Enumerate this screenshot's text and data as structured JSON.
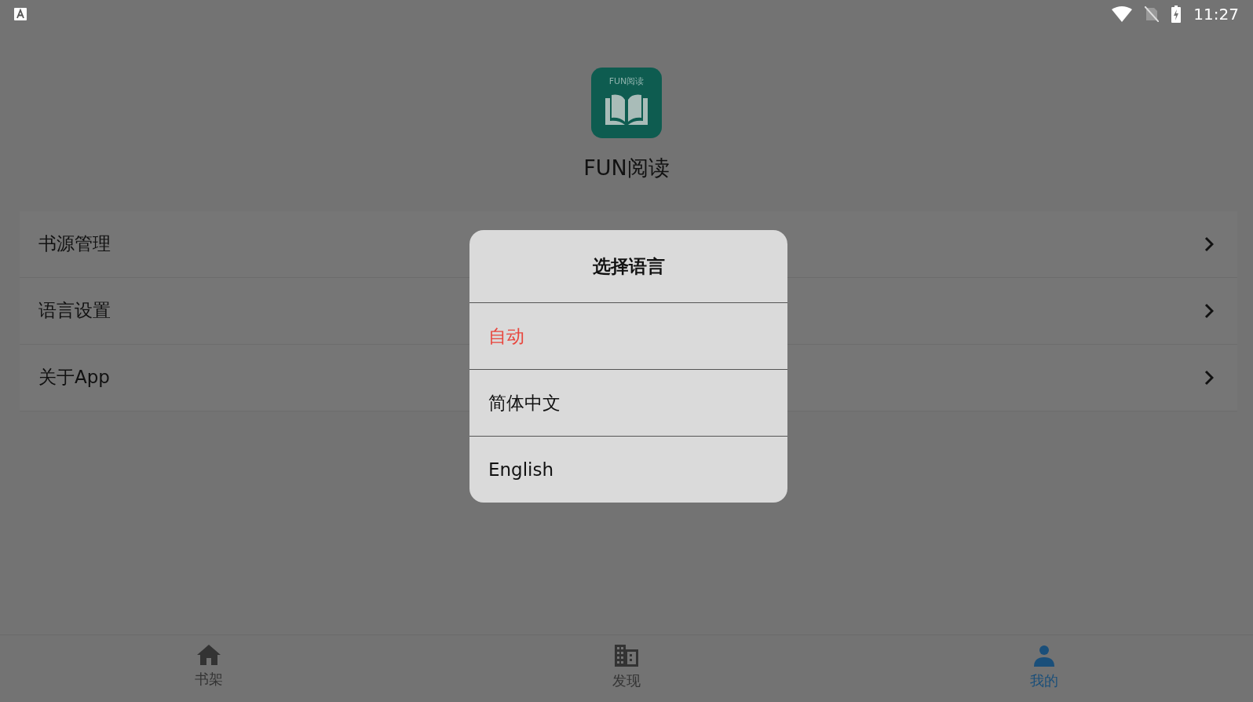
{
  "status_bar": {
    "time": "11:27"
  },
  "app": {
    "logo_text": "FUN阅读",
    "name": "FUN阅读"
  },
  "menu": [
    {
      "label": "书源管理"
    },
    {
      "label": "语言设置"
    },
    {
      "label": "关于App"
    }
  ],
  "dialog": {
    "title": "选择语言",
    "options": [
      {
        "label": "自动",
        "selected": true
      },
      {
        "label": "简体中文",
        "selected": false
      },
      {
        "label": "English",
        "selected": false
      }
    ]
  },
  "bottom_nav": [
    {
      "label": "书架",
      "kind": "home",
      "selected": false
    },
    {
      "label": "发现",
      "kind": "building",
      "selected": false
    },
    {
      "label": "我的",
      "kind": "person",
      "selected": true
    }
  ]
}
